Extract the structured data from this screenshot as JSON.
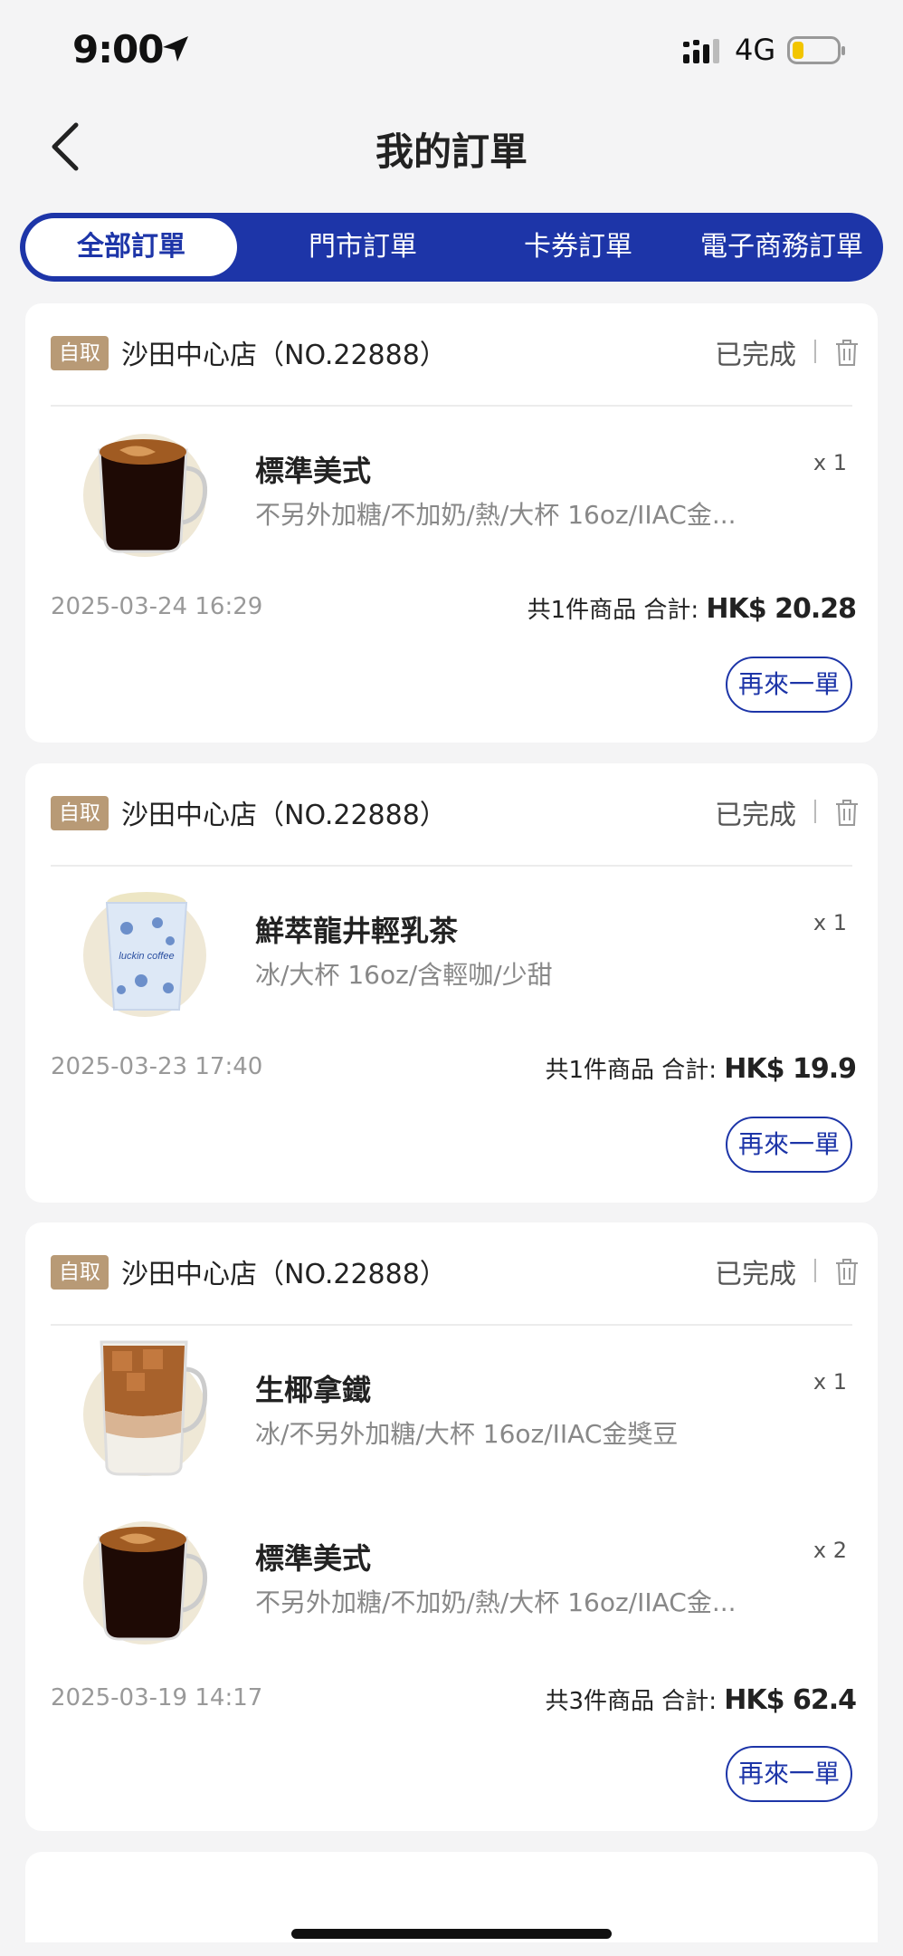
{
  "status_bar": {
    "time": "9:00",
    "network": "4G"
  },
  "nav": {
    "title": "我的訂單"
  },
  "tabs": [
    {
      "label": "全部訂單",
      "active": true
    },
    {
      "label": "門市訂單",
      "active": false
    },
    {
      "label": "卡券訂單",
      "active": false
    },
    {
      "label": "電子商務訂單",
      "active": false
    }
  ],
  "orders": [
    {
      "tag": "自取",
      "store": "沙田中心店（NO.22888）",
      "status": "已完成",
      "items": [
        {
          "name": "標準美式",
          "spec": "不另外加糖/不加奶/熱/大杯 16oz/IIAC金...",
          "qty": "x 1",
          "icon": "hot-americano-icon"
        }
      ],
      "date": "2025-03-24 16:29",
      "summary": "共1件商品  合計: ",
      "amount": "HK$ 20.28",
      "reorder": "再來一單"
    },
    {
      "tag": "自取",
      "store": "沙田中心店（NO.22888）",
      "status": "已完成",
      "items": [
        {
          "name": "鮮萃龍井輕乳茶",
          "spec": "冰/大杯 16oz/含輕咖/少甜",
          "qty": "x 1",
          "icon": "milk-tea-cup-icon",
          "cup_text": "luckin coffee"
        }
      ],
      "date": "2025-03-23 17:40",
      "summary": "共1件商品  合計: ",
      "amount": "HK$ 19.9",
      "reorder": "再來一單"
    },
    {
      "tag": "自取",
      "store": "沙田中心店（NO.22888）",
      "status": "已完成",
      "items": [
        {
          "name": "生椰拿鐵",
          "spec": "冰/不另外加糖/大杯 16oz/IIAC金獎豆",
          "qty": "x 1",
          "icon": "iced-latte-icon"
        },
        {
          "name": "標準美式",
          "spec": "不另外加糖/不加奶/熱/大杯 16oz/IIAC金...",
          "qty": "x 2",
          "icon": "hot-americano-icon"
        }
      ],
      "date": "2025-03-19 14:17",
      "summary": "共3件商品  合計: ",
      "amount": "HK$ 62.4",
      "reorder": "再來一單"
    }
  ],
  "colors": {
    "brand_blue": "#1d35a8",
    "tag_bg": "#b89a76"
  }
}
